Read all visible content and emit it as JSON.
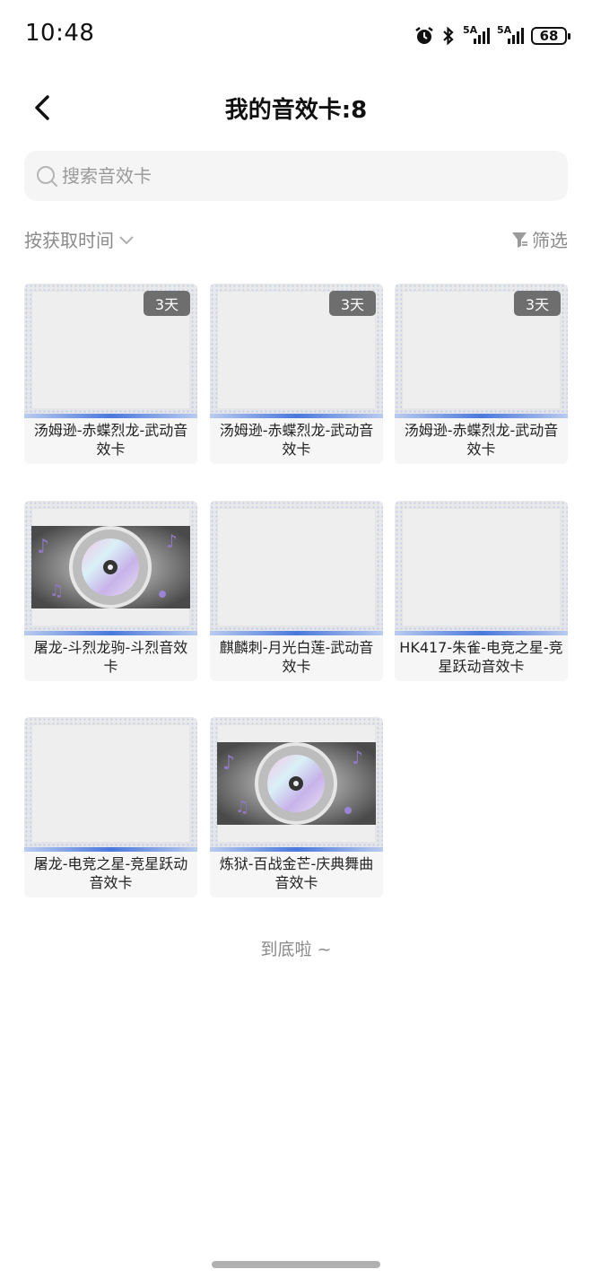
{
  "status_bar": {
    "time": "10:48",
    "network_1": "5A",
    "network_2": "5A",
    "battery": "68"
  },
  "header": {
    "title": "我的音效卡:8"
  },
  "search": {
    "placeholder": "搜索音效卡",
    "value": ""
  },
  "sort": {
    "label": "按获取时间"
  },
  "filter": {
    "label": "筛选"
  },
  "cards": [
    {
      "name": "汤姆逊-赤蝶烈龙-武动音效卡",
      "badge": "3天",
      "art": "blank"
    },
    {
      "name": "汤姆逊-赤蝶烈龙-武动音效卡",
      "badge": "3天",
      "art": "blank"
    },
    {
      "name": "汤姆逊-赤蝶烈龙-武动音效卡",
      "badge": "3天",
      "art": "blank"
    },
    {
      "name": "屠龙-斗烈龙驹-斗烈音效卡",
      "badge": "",
      "art": "disc"
    },
    {
      "name": "麒麟刺-月光白莲-武动音效卡",
      "badge": "",
      "art": "blank"
    },
    {
      "name": "HK417-朱雀-电竞之星-竞星跃动音效卡",
      "badge": "",
      "art": "blank"
    },
    {
      "name": "屠龙-电竞之星-竞星跃动音效卡",
      "badge": "",
      "art": "blank"
    },
    {
      "name": "炼狱-百战金芒-庆典舞曲音效卡",
      "badge": "",
      "art": "disc"
    }
  ],
  "footer": {
    "end_text": "到底啦 ~"
  }
}
